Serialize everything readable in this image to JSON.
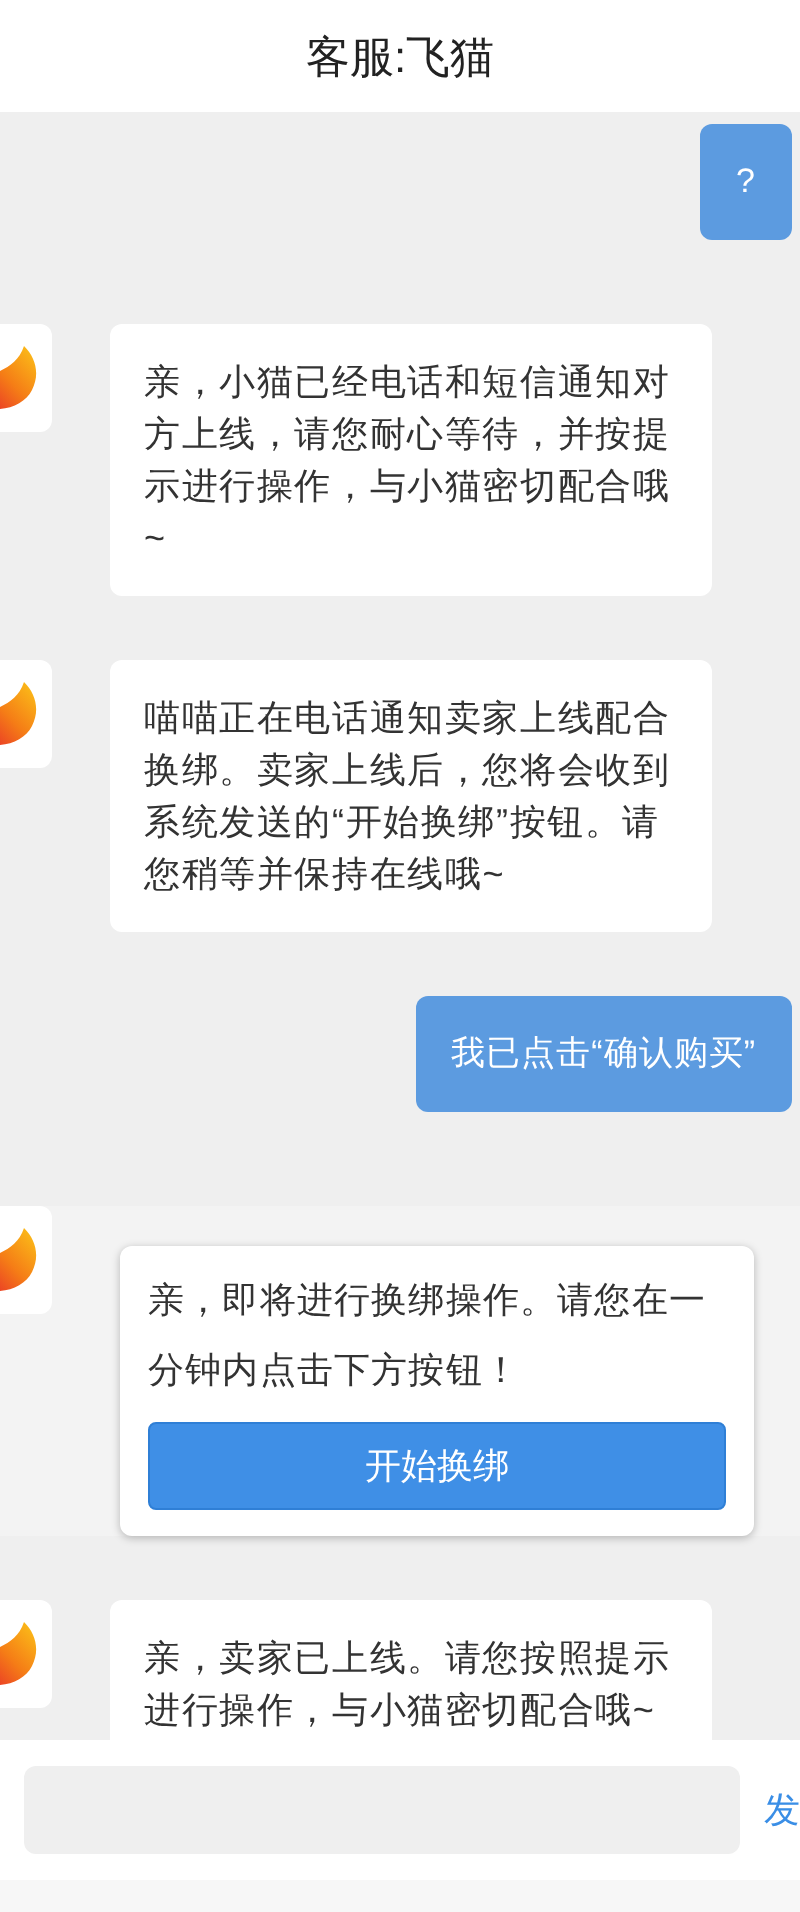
{
  "header": {
    "title": "客服:飞猫"
  },
  "messages": [
    {
      "kind": "user",
      "text": "?"
    },
    {
      "kind": "bot",
      "text": "亲，小猫已经电话和短信通知对方上线，请您耐心等待，并按提示进行操作，与小猫密切配合哦~"
    },
    {
      "kind": "bot",
      "text": "喵喵正在电话通知卖家上线配合换绑。卖家上线后，您将会收到系统发送的“开始换绑”按钮。请您稍等并保持在线哦~"
    },
    {
      "kind": "user",
      "text": "我已点击“确认购买”"
    },
    {
      "kind": "card",
      "text": "亲，即将进行换绑操作。请您在一分钟内点击下方按钮！",
      "button": "开始换绑"
    },
    {
      "kind": "bot",
      "text": "亲，卖家已上线。请您按照提示进行操作，与小猫密切配合哦~"
    }
  ],
  "composer": {
    "send": "发"
  }
}
